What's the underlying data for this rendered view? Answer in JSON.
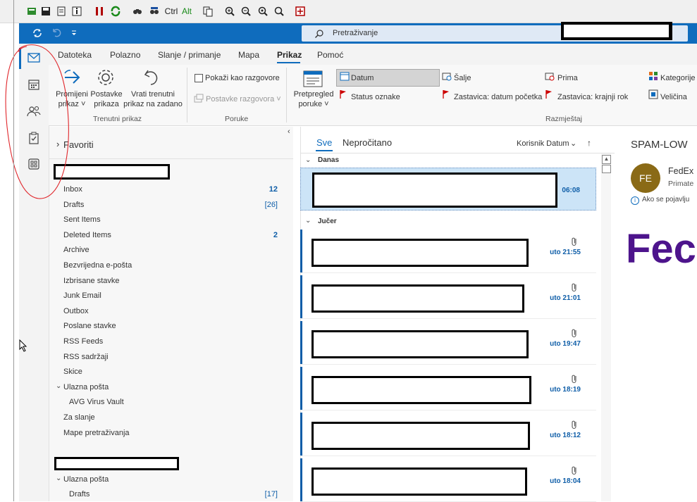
{
  "toolbar": {
    "ctrl_label": "Ctrl",
    "alt_label": "Alt"
  },
  "search": {
    "placeholder": "Pretraživanje"
  },
  "ribbon": {
    "tabs": [
      "Datoteka",
      "Polazno",
      "Slanje / primanje",
      "Mapa",
      "Prikaz",
      "Pomoć"
    ],
    "active_tab": "Prikaz",
    "buttons": {
      "change_view": "Promijeni\nprikaz ˅",
      "view_settings": "Postavke\nprikaza",
      "reset_view": "Vrati trenutni\nprikaz na zadano",
      "show_as_conversations": "Pokaži kao razgovore",
      "conversation_settings": "Postavke razgovora ˅",
      "message_preview": "Pretpregled\nporuke ˅",
      "date": "Datum",
      "from": "Šalje",
      "to": "Prima",
      "categories": "Kategorije",
      "flag_status": "Status oznake",
      "flag_start": "Zastavica: datum početka",
      "flag_due": "Zastavica: krajnji rok",
      "size": "Veličina"
    },
    "groups": {
      "current_view": "Trenutni prikaz",
      "messages": "Poruke",
      "arrangement": "Razmještaj"
    }
  },
  "folders": {
    "favorites": "Favoriti",
    "items": [
      {
        "label": "Inbox",
        "count": "12"
      },
      {
        "label": "Drafts",
        "count": "[26]"
      },
      {
        "label": "Sent Items",
        "count": ""
      },
      {
        "label": "Deleted Items",
        "count": "2"
      },
      {
        "label": "Archive",
        "count": ""
      },
      {
        "label": "Bezvrijedna e-pošta",
        "count": ""
      },
      {
        "label": "Izbrisane stavke",
        "count": ""
      },
      {
        "label": "Junk Email",
        "count": ""
      },
      {
        "label": "Outbox",
        "count": ""
      },
      {
        "label": "Poslane stavke",
        "count": ""
      },
      {
        "label": "RSS Feeds",
        "count": ""
      },
      {
        "label": "RSS sadržaji",
        "count": ""
      },
      {
        "label": "Skice",
        "count": ""
      },
      {
        "label": "Ulazna pošta",
        "count": ""
      },
      {
        "label": "AVG Virus Vault",
        "count": ""
      },
      {
        "label": "Za slanje",
        "count": ""
      },
      {
        "label": "Mape pretraživanja",
        "count": ""
      }
    ],
    "second_account": [
      {
        "label": "Ulazna pošta",
        "count": ""
      },
      {
        "label": "Drafts",
        "count": "[17]"
      }
    ]
  },
  "message_list": {
    "tab_all": "Sve",
    "tab_unread": "Nepročitano",
    "sort_label": "Korisnik Datum",
    "sort_arrow": "↑",
    "group_today": "Danas",
    "group_yesterday": "Jučer",
    "messages_today": [
      {
        "time": "06:08",
        "attachment": false
      }
    ],
    "messages_yesterday": [
      {
        "time": "uto 21:55",
        "attachment": true
      },
      {
        "time": "uto 21:01",
        "attachment": true
      },
      {
        "time": "uto 19:47",
        "attachment": true
      },
      {
        "time": "uto 18:19",
        "attachment": true
      },
      {
        "time": "uto 18:12",
        "attachment": true
      },
      {
        "time": "uto 18:04",
        "attachment": true
      }
    ]
  },
  "reading_pane": {
    "subject": "SPAM-LOW",
    "avatar_initials": "FE",
    "sender": "FedEx",
    "recipient": "Primate",
    "info": "Ako se pojavlju",
    "logo_text": "Fec"
  },
  "colors": {
    "brand_blue": "#0f6cbd",
    "avatar_bg": "#8a6a16",
    "logo_purple": "#4d148c",
    "annotation_red": "#e0262b"
  }
}
